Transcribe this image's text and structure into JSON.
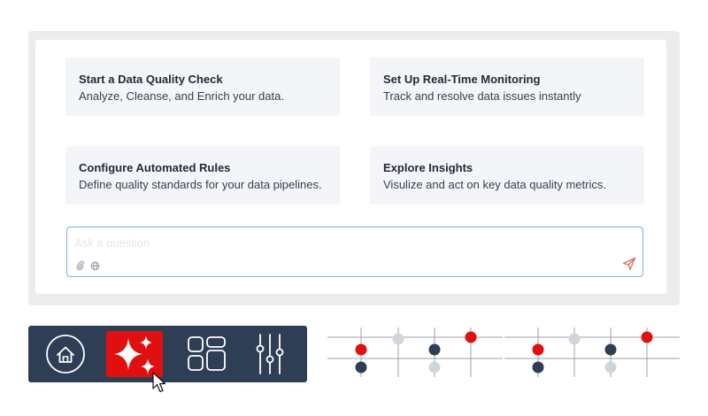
{
  "suggestions": [
    {
      "title": "Start a Data Quality Check",
      "description": "Analyze, Cleanse, and Enrich your data."
    },
    {
      "title": "Set Up Real-Time Monitoring",
      "description": "Track and resolve data issues instantly"
    },
    {
      "title": "Configure Automated Rules",
      "description": "Define quality standards for your data pipelines."
    },
    {
      "title": "Explore Insights",
      "description": "Visulize and act on key data quality metrics."
    }
  ],
  "chat": {
    "placeholder": "Ask a question",
    "icons": [
      "paperclip-icon",
      "globe-icon",
      "send-icon"
    ]
  },
  "nav": {
    "items": [
      {
        "icon": "home-icon",
        "active": false
      },
      {
        "icon": "sparkle-icon",
        "active": true
      },
      {
        "icon": "grid-icon",
        "active": false
      },
      {
        "icon": "sliders-icon",
        "active": false
      }
    ]
  },
  "colors": {
    "accent": "#e01010",
    "nav_bg": "#2e3e55",
    "card_bg": "#f4f5f8",
    "panel_bg": "#ececee",
    "input_border": "#7fb1e0",
    "send": "#e07070",
    "dot_dark": "#2e3e55",
    "dot_light": "#d1d5db",
    "line": "#9aa3b2"
  }
}
